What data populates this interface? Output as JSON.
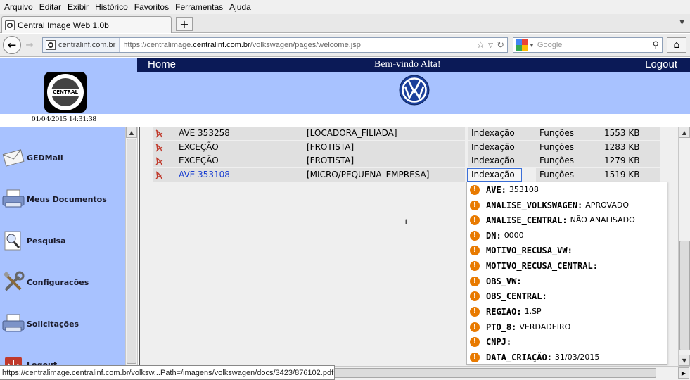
{
  "browser": {
    "menu": [
      "Arquivo",
      "Editar",
      "Exibir",
      "Histórico",
      "Favoritos",
      "Ferramentas",
      "Ajuda"
    ],
    "tab_title": "Central Image Web 1.0b",
    "new_tab_label": "+",
    "identity_label": "centralinf.com.br",
    "url": {
      "prefix": "https://centralimage.",
      "domain": "centralinf.com.br",
      "path": "/volkswagen/pages/welcome.jsp"
    },
    "search_placeholder": "Google",
    "status_text": "https://centralimage.centralinf.com.br/volksw...Path=/imagens/volkswagen/docs/3423/876102.pdf"
  },
  "header": {
    "home_label": "Home",
    "welcome_text": "Bem-vindo Alta!",
    "logout_label": "Logout",
    "logo_text": "CENTRAL",
    "datetime": "01/04/2015 14:31:38"
  },
  "sidebar": {
    "items": [
      {
        "label": "GEDMail",
        "icon": "envelope-icon"
      },
      {
        "label": "Meus Documentos",
        "icon": "printer-icon"
      },
      {
        "label": "Pesquisa",
        "icon": "magnifier-icon"
      },
      {
        "label": "Configurações",
        "icon": "tools-icon"
      },
      {
        "label": "Solicitações",
        "icon": "printer-icon"
      },
      {
        "label": "Logout",
        "icon": "exit-icon"
      }
    ]
  },
  "documents": {
    "rows": [
      {
        "name": "AVE 353258",
        "category": "[LOCADORA_FILIADA]",
        "action1": "Indexação",
        "action2": "Funções",
        "size": "1553 KB",
        "selected": false
      },
      {
        "name": "EXCEÇÃO",
        "category": "[FROTISTA]",
        "action1": "Indexação",
        "action2": "Funções",
        "size": "1283 KB",
        "selected": false
      },
      {
        "name": "EXCEÇÃO",
        "category": "[FROTISTA]",
        "action1": "Indexação",
        "action2": "Funções",
        "size": "1279 KB",
        "selected": false
      },
      {
        "name": "AVE 353108",
        "category": "[MICRO/PEQUENA_EMPRESA]",
        "action1": "Indexação",
        "action2": "Funções",
        "size": "1519 KB",
        "selected": true
      }
    ],
    "page_number": "1"
  },
  "index_popup": {
    "fields": [
      {
        "key": "AVE:",
        "value": "353108"
      },
      {
        "key": "ANALISE_VOLKSWAGEN:",
        "value": "APROVADO"
      },
      {
        "key": "ANALISE_CENTRAL:",
        "value": "NÃO ANALISADO"
      },
      {
        "key": "DN:",
        "value": "0000"
      },
      {
        "key": "MOTIVO_RECUSA_VW:",
        "value": ""
      },
      {
        "key": "MOTIVO_RECUSA_CENTRAL:",
        "value": ""
      },
      {
        "key": "OBS_VW:",
        "value": ""
      },
      {
        "key": "OBS_CENTRAL:",
        "value": ""
      },
      {
        "key": "REGIAO:",
        "value": "1.SP"
      },
      {
        "key": "PTO_8:",
        "value": "VERDADEIRO"
      },
      {
        "key": "CNPJ:",
        "value": ""
      },
      {
        "key": "DATA_CRIAÇÃO:",
        "value": "31/03/2015"
      }
    ]
  },
  "colors": {
    "header_blue": "#a8c2ff",
    "top_strip": "#0b1a57",
    "link_blue": "#1a3fd1",
    "warning_orange": "#e87a00",
    "pdf_red": "#c0392b"
  }
}
